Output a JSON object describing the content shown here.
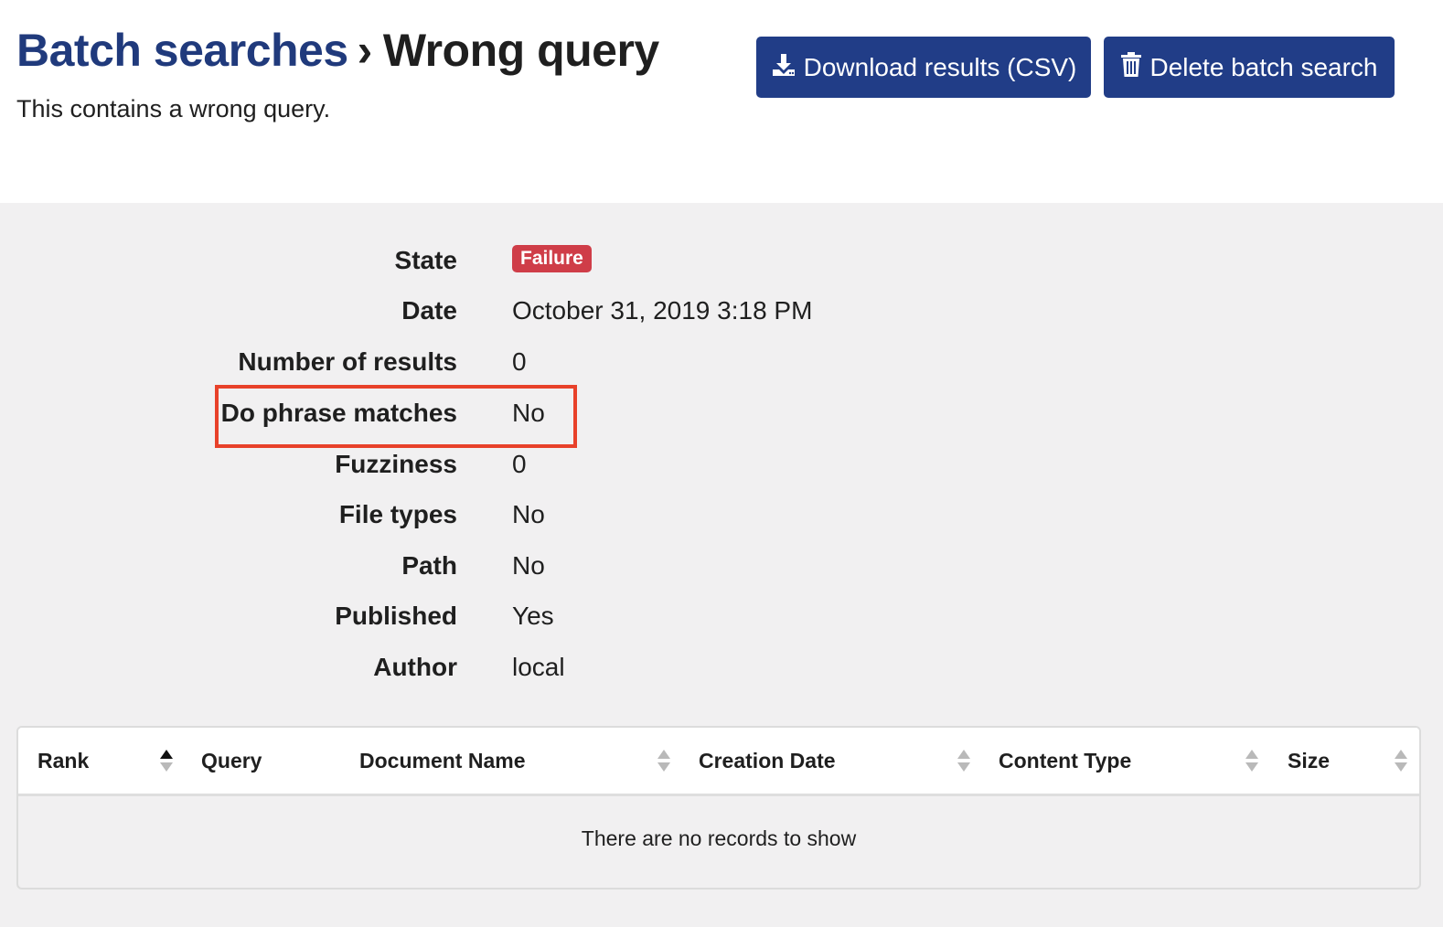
{
  "header": {
    "breadcrumb_parent": "Batch searches",
    "breadcrumb_separator": "›",
    "title": "Wrong query",
    "description": "This contains a wrong query."
  },
  "actions": {
    "download_label": "Download results (CSV)",
    "download_icon": "download-icon",
    "delete_label": "Delete batch search",
    "delete_icon": "trash-icon"
  },
  "details": {
    "state": {
      "label": "State",
      "value": "Failure",
      "badge_color": "#cf3d48"
    },
    "date": {
      "label": "Date",
      "value": "October 31, 2019 3:18 PM"
    },
    "number_of_results": {
      "label": "Number of results",
      "value": "0"
    },
    "phrase_matches": {
      "label": "Do phrase matches",
      "value": "No"
    },
    "fuzziness": {
      "label": "Fuzziness",
      "value": "0"
    },
    "file_types": {
      "label": "File types",
      "value": "No"
    },
    "path": {
      "label": "Path",
      "value": "No"
    },
    "published": {
      "label": "Published",
      "value": "Yes"
    },
    "author": {
      "label": "Author",
      "value": "local"
    }
  },
  "table": {
    "columns": [
      {
        "label": "Rank",
        "sort": "ascending"
      },
      {
        "label": "Query",
        "sort": "none"
      },
      {
        "label": "Document Name",
        "sort": "none"
      },
      {
        "label": "Creation Date",
        "sort": "none"
      },
      {
        "label": "Content Type",
        "sort": "none"
      },
      {
        "label": "Size",
        "sort": "none"
      }
    ],
    "empty_message": "There are no records to show"
  },
  "colors": {
    "primary": "#213d87",
    "link": "#203a7c",
    "danger": "#cf3d48",
    "highlight": "#e8412a",
    "panel_background": "#f1f0f1"
  }
}
